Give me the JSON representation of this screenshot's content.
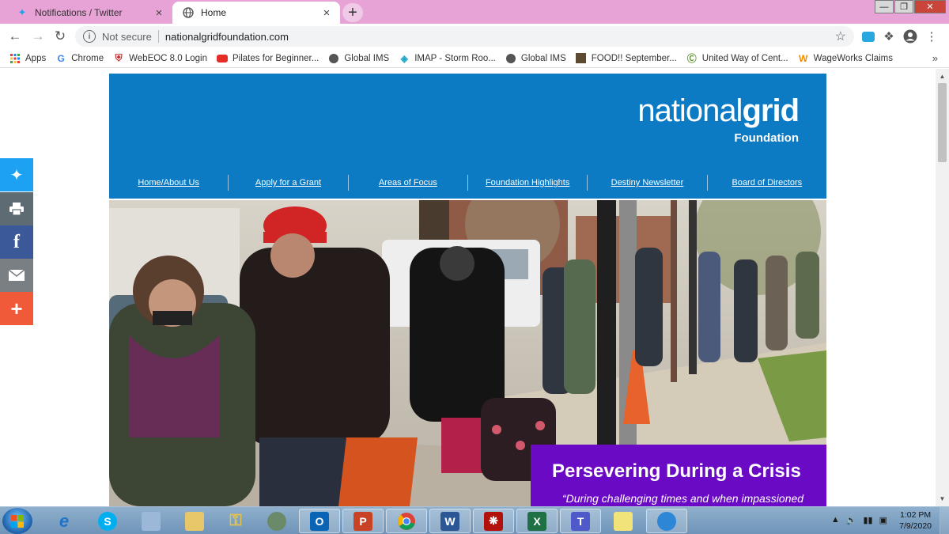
{
  "browser": {
    "tabs": [
      {
        "title": "Notifications / Twitter",
        "icon": "twitter-bird-icon"
      },
      {
        "title": "Home",
        "icon": "globe-icon"
      }
    ],
    "address": {
      "security": "Not secure",
      "url": "nationalgridfoundation.com"
    },
    "bookmarks": [
      {
        "label": "Apps",
        "icon": "apps-grid-icon"
      },
      {
        "label": "Chrome",
        "icon": "google-g-icon"
      },
      {
        "label": "WebEOC 8.0  Login",
        "icon": "webeoc-shield-icon"
      },
      {
        "label": "Pilates for Beginner...",
        "icon": "youtube-icon"
      },
      {
        "label": "Global IMS",
        "icon": "globe-icon"
      },
      {
        "label": "IMAP - Storm Roo...",
        "icon": "imap-icon"
      },
      {
        "label": "Global IMS",
        "icon": "globe-icon"
      },
      {
        "label": "FOOD!! September...",
        "icon": "photo-icon"
      },
      {
        "label": "United Way of Cent...",
        "icon": "united-way-icon"
      },
      {
        "label": "WageWorks Claims",
        "icon": "wageworks-icon"
      }
    ]
  },
  "page": {
    "logo": {
      "brand_light": "national",
      "brand_bold": "grid",
      "sub": "Foundation"
    },
    "nav": [
      "Home/About Us",
      "Apply for a Grant",
      "Areas of Focus",
      "Foundation Highlights",
      "Destiny Newsletter",
      "Board of Directors"
    ],
    "share": [
      "twitter-icon",
      "print-icon",
      "facebook-icon",
      "email-icon",
      "more-plus-icon"
    ],
    "hero": {
      "heading": "Persevering During a Crisis",
      "quote": "“During challenging times and when impassioned"
    }
  },
  "taskbar": {
    "apps": [
      "internet-explorer-icon",
      "skype-icon",
      "notepad-icon",
      "file-explorer-icon",
      "key-app-icon",
      "globe-app-icon",
      "outlook-icon",
      "powerpoint-icon",
      "chrome-icon",
      "word-icon",
      "acrobat-icon",
      "excel-icon",
      "teams-icon",
      "sticky-notes-icon",
      "cloud-app-icon"
    ],
    "time": "1:02 PM",
    "date": "7/9/2020"
  },
  "colors": {
    "tabstrip": "#e7a3d6",
    "header_blue": "#0d7ac4",
    "crisis_purple": "#6b0ac4"
  }
}
